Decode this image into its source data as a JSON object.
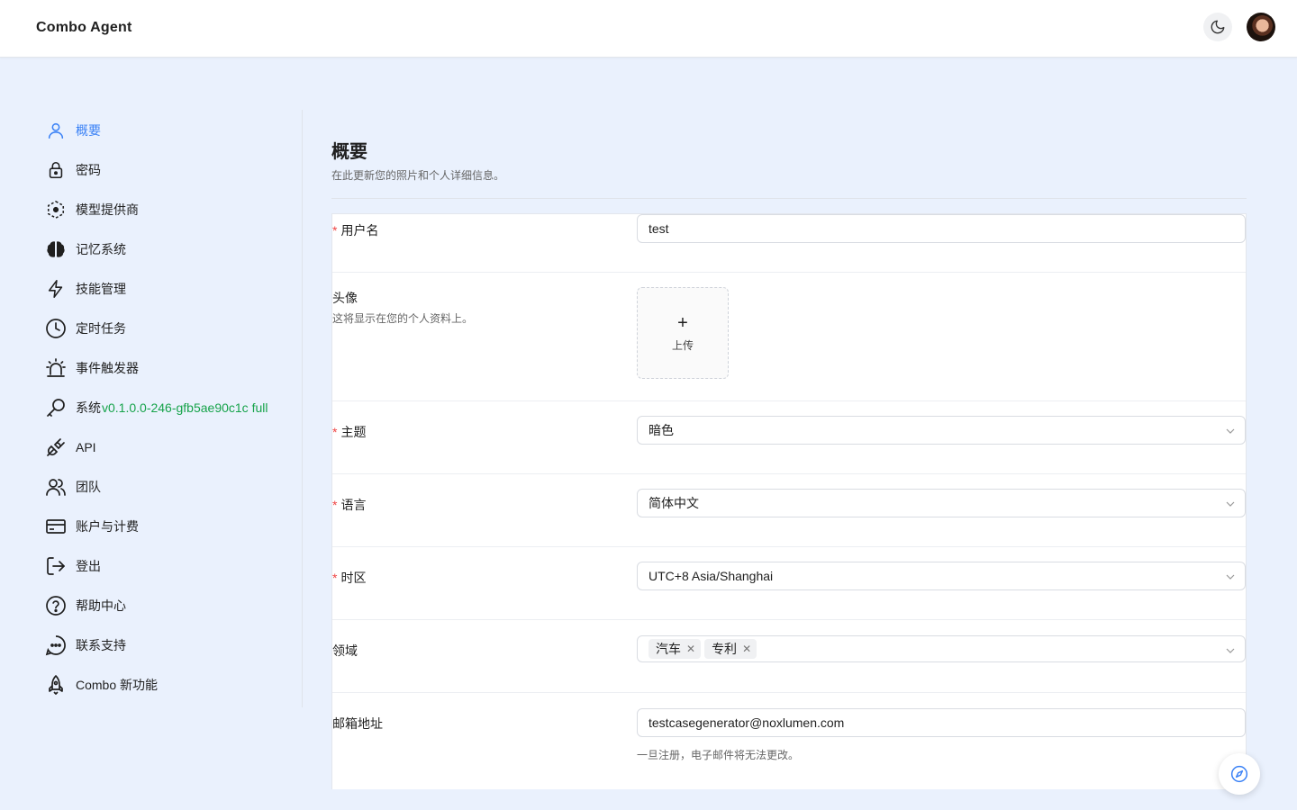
{
  "header": {
    "title": "Combo Agent",
    "theme_toggle_icon": "moon-icon",
    "avatar_icon": "user-avatar"
  },
  "sidebar": {
    "items": [
      {
        "label": "概要",
        "icon": "user-icon",
        "active": true
      },
      {
        "label": "密码",
        "icon": "lock-icon"
      },
      {
        "label": "模型提供商",
        "icon": "model-provider-icon"
      },
      {
        "label": "记忆系统",
        "icon": "brain-icon"
      },
      {
        "label": "技能管理",
        "icon": "lightning-icon"
      },
      {
        "label": "定时任务",
        "icon": "clock-icon"
      },
      {
        "label": "事件触发器",
        "icon": "alarm-icon"
      },
      {
        "label": "系统",
        "version": "v0.1.0.0-246-gfb5ae90c1c full",
        "icon": "wrench-icon"
      },
      {
        "label": "API",
        "icon": "plug-icon"
      },
      {
        "label": "团队",
        "icon": "team-icon"
      },
      {
        "label": "账户与计费",
        "icon": "credit-card-icon"
      },
      {
        "label": "登出",
        "icon": "logout-icon"
      },
      {
        "label": "帮助中心",
        "icon": "help-icon"
      },
      {
        "label": "联系支持",
        "icon": "chat-icon"
      },
      {
        "label": "Combo 新功能",
        "icon": "rocket-icon"
      }
    ]
  },
  "main": {
    "title": "概要",
    "subtitle": "在此更新您的照片和个人详细信息。",
    "form": {
      "username": {
        "label": "用户名",
        "value": "test"
      },
      "avatar": {
        "label": "头像",
        "hint": "这将显示在您的个人资料上。",
        "upload_label": "上传"
      },
      "theme": {
        "label": "主题",
        "value": "暗色"
      },
      "language": {
        "label": "语言",
        "value": "简体中文"
      },
      "timezone": {
        "label": "时区",
        "value": "UTC+8 Asia/Shanghai"
      },
      "domain": {
        "label": "领域",
        "tags": [
          "汽车",
          "专利"
        ]
      },
      "email": {
        "label": "邮箱地址",
        "value": "testcasegenerator@noxlumen.com",
        "hint": "一旦注册，电子邮件将无法更改。"
      }
    }
  },
  "fab": {
    "icon": "compass-icon"
  },
  "colors": {
    "accent": "#3b82f6",
    "version": "#16a34a",
    "required": "#ef4444",
    "background": "#eaf1fd"
  }
}
